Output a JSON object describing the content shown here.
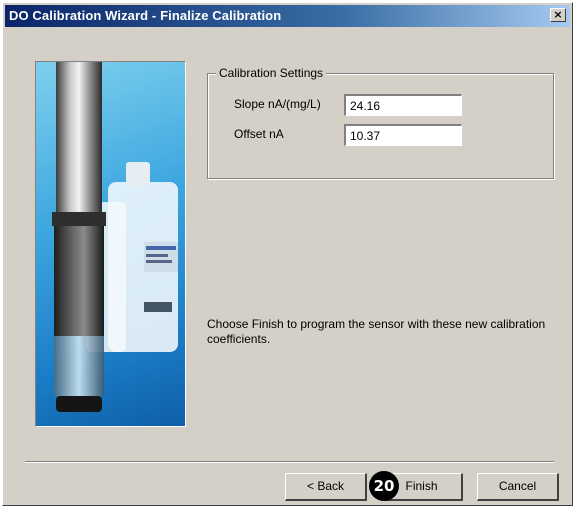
{
  "window": {
    "title": "DO Calibration Wizard - Finalize Calibration",
    "close_symbol": "×",
    "titlebar_colors": {
      "start": "#0a246a",
      "end": "#a6caf0"
    },
    "face_color": "#d4d0c8"
  },
  "picture": {
    "icon": "do-sensor-probe-image"
  },
  "calibration_settings": {
    "legend": "Calibration Settings",
    "slope": {
      "label": "Slope  nA/(mg/L)",
      "value": "24.16"
    },
    "offset": {
      "label": "Offset  nA",
      "value": "10.37"
    }
  },
  "instructions": "Choose Finish to program the sensor with these new calibration coefficients.",
  "buttons": {
    "back": "< Back",
    "finish": "Finish",
    "cancel": "Cancel"
  },
  "callout_badge": "20"
}
